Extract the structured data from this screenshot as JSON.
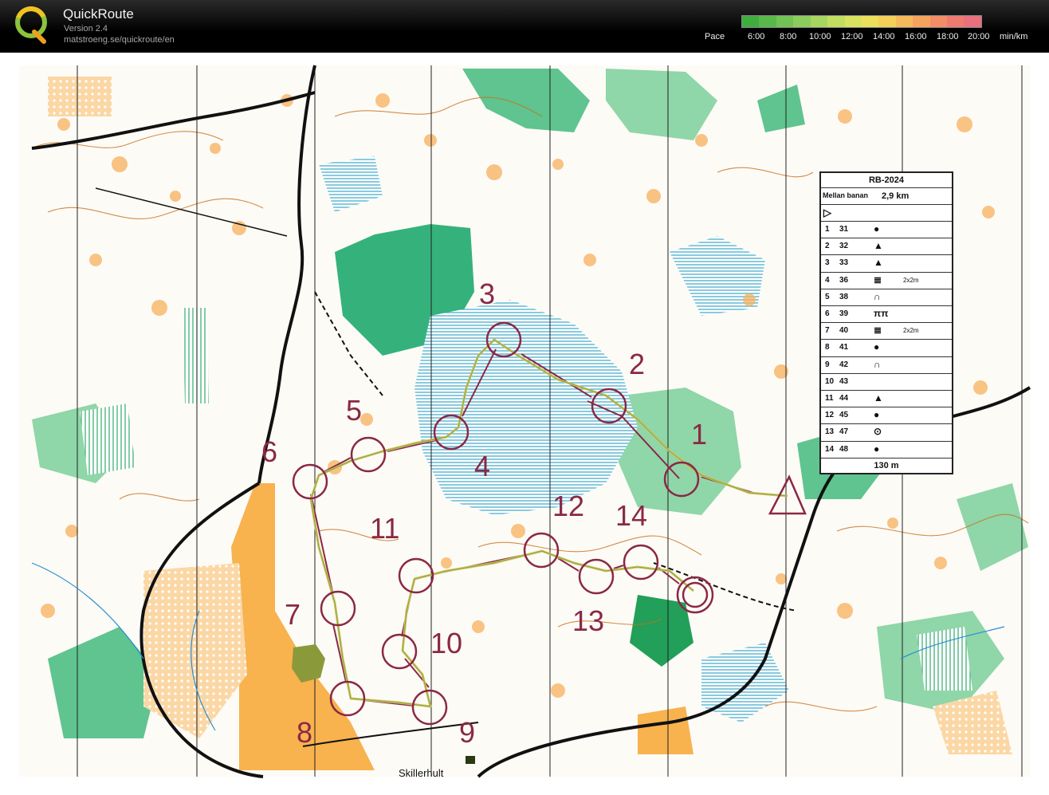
{
  "app": {
    "title": "QuickRoute",
    "version": "Version 2.4",
    "url": "matstroeng.se/quickroute/en"
  },
  "pace_scale": {
    "label": "Pace",
    "ticks": [
      "6:00",
      "8:00",
      "10:00",
      "12:00",
      "14:00",
      "16:00",
      "18:00",
      "20:00"
    ],
    "unit": "min/km",
    "colors": [
      "#3fae3f",
      "#58b84a",
      "#72c255",
      "#8ccc5c",
      "#a6d65f",
      "#c0de60",
      "#d8e25e",
      "#ecdf5a",
      "#f4cf59",
      "#f6ba5b",
      "#f6a35e",
      "#f38d65",
      "#ee7a70",
      "#e9707c"
    ]
  },
  "map": {
    "place_name": "Skillerhult",
    "course_color": "#8a2846",
    "controls": [
      "1",
      "2",
      "3",
      "4",
      "5",
      "6",
      "7",
      "8",
      "9",
      "10",
      "11",
      "12",
      "13",
      "14"
    ]
  },
  "description_sheet": {
    "event": "RB-2024",
    "course": "Mellan banan",
    "length": "2,9 km",
    "rows": [
      {
        "n": "1",
        "code": "31",
        "sym": "●",
        "extra": ""
      },
      {
        "n": "2",
        "code": "32",
        "sym": "▲",
        "extra": ""
      },
      {
        "n": "3",
        "code": "33",
        "sym": "▲",
        "extra": ""
      },
      {
        "n": "4",
        "code": "36",
        "sym": "≣",
        "extra": "2x2m"
      },
      {
        "n": "5",
        "code": "38",
        "sym": "∩",
        "extra": ""
      },
      {
        "n": "6",
        "code": "39",
        "sym": "ππ",
        "extra": ""
      },
      {
        "n": "7",
        "code": "40",
        "sym": "≣",
        "extra": "2x2m"
      },
      {
        "n": "8",
        "code": "41",
        "sym": "●",
        "extra": ""
      },
      {
        "n": "9",
        "code": "42",
        "sym": "∩",
        "extra": ""
      },
      {
        "n": "10",
        "code": "43",
        "sym": "",
        "extra": ""
      },
      {
        "n": "11",
        "code": "44",
        "sym": "▲",
        "extra": ""
      },
      {
        "n": "12",
        "code": "45",
        "sym": "●",
        "extra": ""
      },
      {
        "n": "13",
        "code": "47",
        "sym": "⊙",
        "extra": ""
      },
      {
        "n": "14",
        "code": "48",
        "sym": "●",
        "extra": ""
      }
    ],
    "finish_distance": "130 m"
  }
}
